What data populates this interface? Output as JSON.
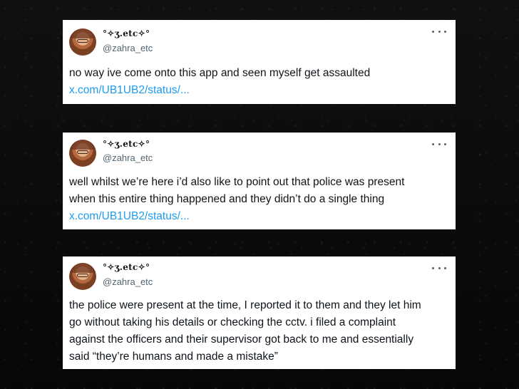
{
  "tweets": [
    {
      "display_name": "°✧ʒ.etc✧°",
      "handle": "@zahra_etc",
      "text_lines": [
        "no way ive come onto this app and seen myself get assaulted"
      ],
      "link": "x.com/UB1UB2/status/..."
    },
    {
      "display_name": "°✧ʒ.etc✧°",
      "handle": "@zahra_etc",
      "text_lines": [
        "well whilst we’re here i’d also like to point out that police was present",
        "when this entire thing happened and they didn’t do a single thing"
      ],
      "link": "x.com/UB1UB2/status/..."
    },
    {
      "display_name": "°✧ʒ.etc✧°",
      "handle": "@zahra_etc",
      "text_lines": [
        "the police were present at the time, I reported it to them and they let him",
        "go without taking his details or checking the cctv. i filed a complaint",
        "against the officers and their supervisor got back to me and essentially",
        "said “they’re humans and made a mistake”"
      ],
      "link": ""
    }
  ],
  "icons": {
    "more": "more-options-icon",
    "avatar": "avatar"
  },
  "colors": {
    "background": "#0b0b0b",
    "card": "#ffffff",
    "text": "#0f1419",
    "secondary_text": "#536471",
    "link": "#1d9bf0"
  }
}
